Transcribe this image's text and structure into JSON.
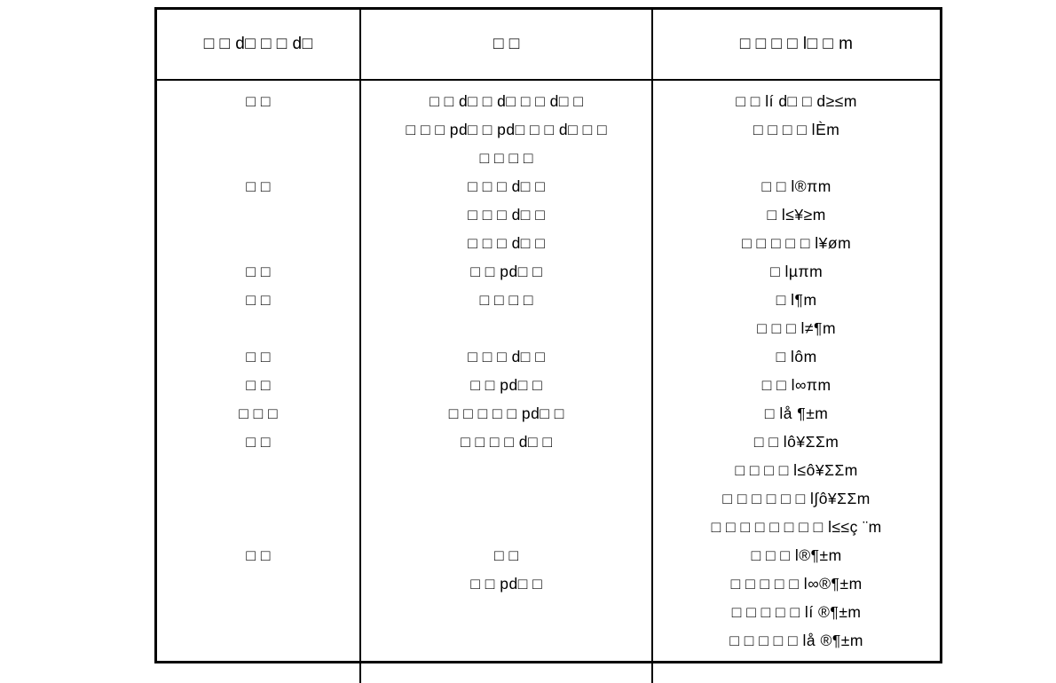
{
  "document": {
    "type": "table",
    "page_background": "#ffffff",
    "text_color": "#000000",
    "border_color": "#000000",
    "note": "Three-column table; most characters render as missing-glyph (tofu) boxes with a few legible Latin and symbol glyphs."
  },
  "table": {
    "columns": [
      {
        "key": "col1",
        "header": "□ □ d□ □ □ d□"
      },
      {
        "key": "col2",
        "header": "□ □"
      },
      {
        "key": "col3",
        "header": "□ □ □ □ l□ □ m"
      }
    ],
    "col1_lines": [
      "□ □",
      "",
      "",
      "□ □",
      "",
      "",
      "□ □",
      "□ □",
      "",
      "□ □",
      "□ □",
      "□ □ □",
      "□ □",
      "",
      "",
      "",
      "□ □",
      "",
      "",
      ""
    ],
    "col2_lines": [
      "□ □ d□ □ d□ □ □ d□ □",
      "□ □ □ pd□ □ pd□ □ □ d□ □ □",
      "□ □ □ □",
      "□ □ □ d□ □",
      "□ □ □ d□ □",
      "□ □ □ d□ □",
      "□ □ pd□ □",
      "□ □ □ □",
      "",
      "□ □ □ d□ □",
      "□ □ pd□ □",
      "□ □ □ □ □ pd□ □",
      "□ □ □ □ d□ □",
      "",
      "",
      "",
      "□ □",
      "□ □ pd□ □",
      "",
      "",
      ""
    ],
    "col3_lines": [
      "□ □ lí d□ □ d≥≤m",
      "□ □ □ □ lÈm",
      "",
      "□ □ l®πm",
      "□ l≤¥≥m",
      "□ □ □ □ □ l¥øm",
      "□ lµπm",
      "□ l¶m",
      "□ □ □ l≠¶m",
      "□ lôm",
      "□ □ l∞πm",
      "□ lå ¶±m",
      "□ □ lô¥ΣΣm",
      "□ □ □ □ l≤ô¥ΣΣm",
      "□ □ □ □ □ □ l∫ô¥ΣΣm",
      "□ □ □ □ □ □ □ □ l≤≤ç ¨m",
      "□ □ □ l®¶±m",
      "□ □ □ □ □ l∞®¶±m",
      "□ □ □ □ □ lí ®¶±m",
      "□ □ □ □ □ lå ®¶±m"
    ]
  }
}
